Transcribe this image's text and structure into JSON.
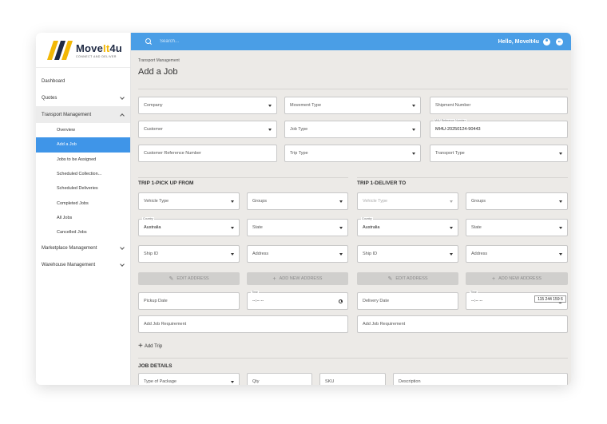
{
  "brand": {
    "name": "Move",
    "name_highlight": "It",
    "name_suffix": "4u",
    "tagline": "CONNECT AND DELIVER",
    "color_dark": "#1f2a44",
    "color_accent": "#f2b705"
  },
  "topbar": {
    "search_placeholder": "Search...",
    "greeting": "Hello, MoveIt4u",
    "color": "#4a9ee6"
  },
  "sidebar": {
    "items": [
      {
        "label": "Dashboard"
      },
      {
        "label": "Quotes"
      },
      {
        "label": "Transport Management"
      },
      {
        "label": "Marketplace Management"
      },
      {
        "label": "Warehouse Management"
      }
    ],
    "sub_items": [
      {
        "label": "Overview"
      },
      {
        "label": "Add a Job"
      },
      {
        "label": "Jobs to be Assigned"
      },
      {
        "label": "Scheduled Collection..."
      },
      {
        "label": "Scheduled Deliveries"
      },
      {
        "label": "Completed Jobs"
      },
      {
        "label": "All Jobs"
      },
      {
        "label": "Cancelled Jobs"
      }
    ],
    "active_color": "#3f95e8"
  },
  "page": {
    "breadcrumb": "Transport Management",
    "title": "Add a Job"
  },
  "job": {
    "company": "Company",
    "movement_type": "Movement Type",
    "shipment_number": "Shipment Number",
    "customer": "Customer",
    "job_type": "Job Type",
    "m4u_ref_label": "M4U Reference Number",
    "m4u_ref_value": "MI4U-20250124-90443",
    "customer_ref": "Customer Reference Number",
    "trip_type": "Trip Type",
    "transport_type": "Transport Type"
  },
  "pickup": {
    "heading": "TRIP 1-PICK UP FROM",
    "vehicle_type": "Vehicle Type",
    "groups": "Groups",
    "country_label": "Country",
    "country_value": "Australia",
    "state": "State",
    "ship_id": "Ship ID",
    "address": "Address",
    "edit_address": "EDIT ADDRESS",
    "add_address": "ADD NEW ADDRESS",
    "date": "Pickup Date",
    "time_label": "Time",
    "time_value": "--:-- --",
    "requirement": "Add Job Requirement"
  },
  "delivery": {
    "heading": "TRIP 1-DELIVER TO",
    "vehicle_type": "Vehicle Type",
    "groups": "Groups",
    "country_label": "Country",
    "country_value": "Australia",
    "state": "State",
    "ship_id": "Ship ID",
    "address": "Address",
    "edit_address": "EDIT ADDRESS",
    "add_address": "ADD NEW ADDRESS",
    "date": "Delivery Date",
    "time_label": "Time",
    "time_value": "--:-- --",
    "requirement": "Add Job Requirement"
  },
  "tooltip": "115 244 159 6",
  "add_trip": "Add Trip",
  "details": {
    "heading": "JOB DETAILS",
    "package_type": "Type of Package",
    "qty": "Qty",
    "sku": "SKU",
    "description": "Description"
  }
}
